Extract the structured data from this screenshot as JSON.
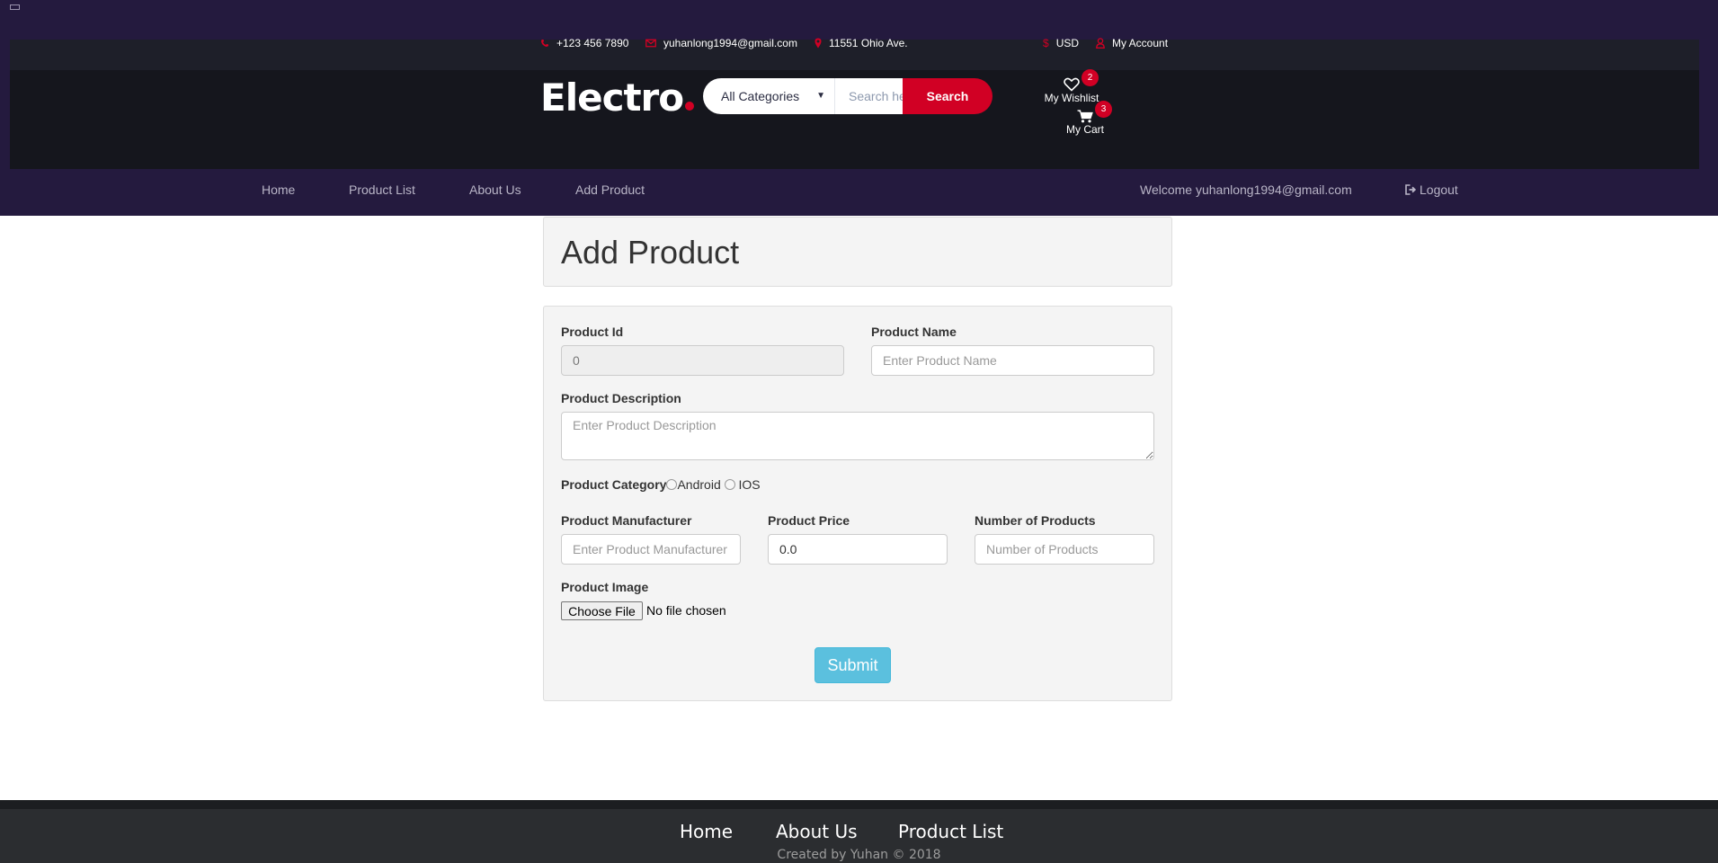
{
  "header_top": {
    "phone": "+123 456 7890",
    "email": "yuhanlong1994@gmail.com",
    "address": "11551 Ohio Ave.",
    "currency": "USD",
    "account": "My Account"
  },
  "brand": {
    "logo_text": "Electro",
    "accent_color": "#d10024"
  },
  "search": {
    "category": "All Categories",
    "placeholder": "Search here",
    "button": "Search"
  },
  "header_links": {
    "wishlist_label": "My Wishlist",
    "wishlist_count": "2",
    "cart_label": "My Cart",
    "cart_count": "3"
  },
  "nav": {
    "items": [
      "Home",
      "Product List",
      "About Us",
      "Add Product"
    ],
    "welcome": "Welcome yuhanlong1994@gmail.com",
    "logout": "Logout"
  },
  "page": {
    "title": "Add Product"
  },
  "form": {
    "product_id_label": "Product Id",
    "product_id_value": "0",
    "product_name_label": "Product Name",
    "product_name_placeholder": "Enter Product Name",
    "description_label": "Product Description",
    "description_placeholder": "Enter Product Description",
    "category_label": "Product Category",
    "category_options": [
      "Android",
      "IOS"
    ],
    "manufacturer_label": "Product Manufacturer",
    "manufacturer_placeholder": "Enter Product Manufacturer",
    "price_label": "Product Price",
    "price_value": "0.0",
    "count_label": "Number of Products",
    "count_placeholder": "Number of Products",
    "image_label": "Product Image",
    "file_button": "Choose File",
    "file_status": "No file chosen",
    "submit": "Submit"
  },
  "footer": {
    "links": [
      "Home",
      "About Us",
      "Product List"
    ],
    "credit": "Created by Yuhan © 2018"
  }
}
